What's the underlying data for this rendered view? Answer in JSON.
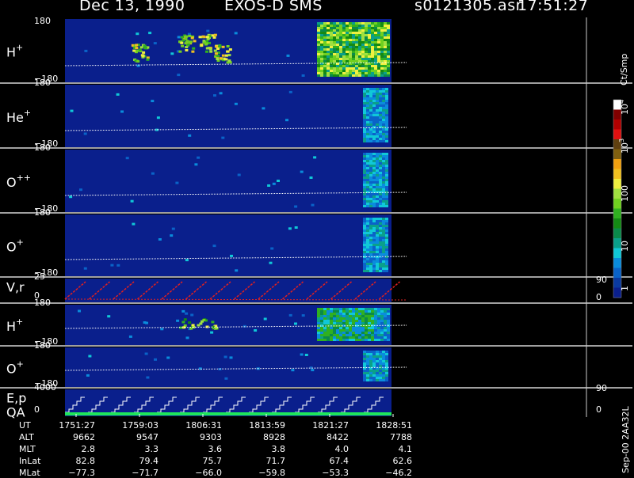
{
  "header": {
    "date": "Dec 13, 1990",
    "instrument": "EXOS-D SMS",
    "file": "s0121305.asr",
    "time": "17:51:27"
  },
  "colors": {
    "background": "#000000",
    "plot_bg": "#0a1f8c",
    "separator": "#ffffff",
    "trace": "#e02020",
    "qa": "#1ee65a"
  },
  "colorbar": {
    "title": "Ct/Smp",
    "ticks": [
      "1",
      "10",
      "100",
      "10",
      "10"
    ],
    "tick_exponents": [
      "",
      "",
      "",
      "3",
      "4"
    ],
    "segments": [
      "#0a1f8c",
      "#0a3aa0",
      "#0a63c8",
      "#0a8cdc",
      "#10c8d8",
      "#0aa08a",
      "#0a8a4a",
      "#148a14",
      "#30b020",
      "#70d020",
      "#a0e040",
      "#f0f040",
      "#f0c020",
      "#f0a010",
      "#806010",
      "#604010",
      "#e01010",
      "#b00000",
      "#800000",
      "#ffffff"
    ]
  },
  "chart_data": {
    "type": "heatmap",
    "panels": [
      {
        "name": "H+",
        "label_base": "H",
        "label_sup": "+",
        "ytop": "180",
        "ybottom": "−180"
      },
      {
        "name": "He+",
        "label_base": "He",
        "label_sup": "+",
        "ytop": "180",
        "ybottom": "−180"
      },
      {
        "name": "O++",
        "label_base": "O",
        "label_sup": "++",
        "ytop": "180",
        "ybottom": "−180"
      },
      {
        "name": "O+",
        "label_base": "O",
        "label_sup": "+",
        "ytop": "180",
        "ybottom": "−180"
      },
      {
        "name": "V,r",
        "label_base": "V,r",
        "label_sup": "",
        "ytop": "25",
        "ybottom": "0",
        "right_top": "90",
        "right_bottom": "0"
      },
      {
        "name": "H+ (2)",
        "label_base": "H",
        "label_sup": "+",
        "ytop": "180",
        "ybottom": "−180"
      },
      {
        "name": "O+ (2)",
        "label_base": "O",
        "label_sup": "+",
        "ytop": "180",
        "ybottom": "−180"
      },
      {
        "name": "E,p / QA",
        "label_base": "E,p",
        "label_sup": "",
        "label2": "QA",
        "ytop": "4000",
        "ybottom": "0",
        "right_top": "90",
        "right_bottom": "0"
      }
    ],
    "time_ticks": [
      "1751:27",
      "1759:03",
      "1806:31",
      "1813:59",
      "1821:27",
      "1828:51"
    ],
    "ephemeris": {
      "rows": [
        {
          "label": "UT",
          "values": [
            "1751:27",
            "1759:03",
            "1806:31",
            "1813:59",
            "1821:27",
            "1828:51"
          ]
        },
        {
          "label": "ALT",
          "values": [
            "9662",
            "9547",
            "9303",
            "8928",
            "8422",
            "7788"
          ]
        },
        {
          "label": "MLT",
          "values": [
            "2.8",
            "3.3",
            "3.6",
            "3.8",
            "4.0",
            "4.1"
          ]
        },
        {
          "label": "InLat",
          "values": [
            "82.8",
            "79.4",
            "75.7",
            "71.7",
            "67.4",
            "62.6"
          ]
        },
        {
          "label": "MLat",
          "values": [
            "−77.3",
            "−71.7",
            "−66.0",
            "−59.8",
            "−53.3",
            "−46.2"
          ]
        }
      ]
    },
    "side_note": "Sep-00 2AA32L"
  }
}
